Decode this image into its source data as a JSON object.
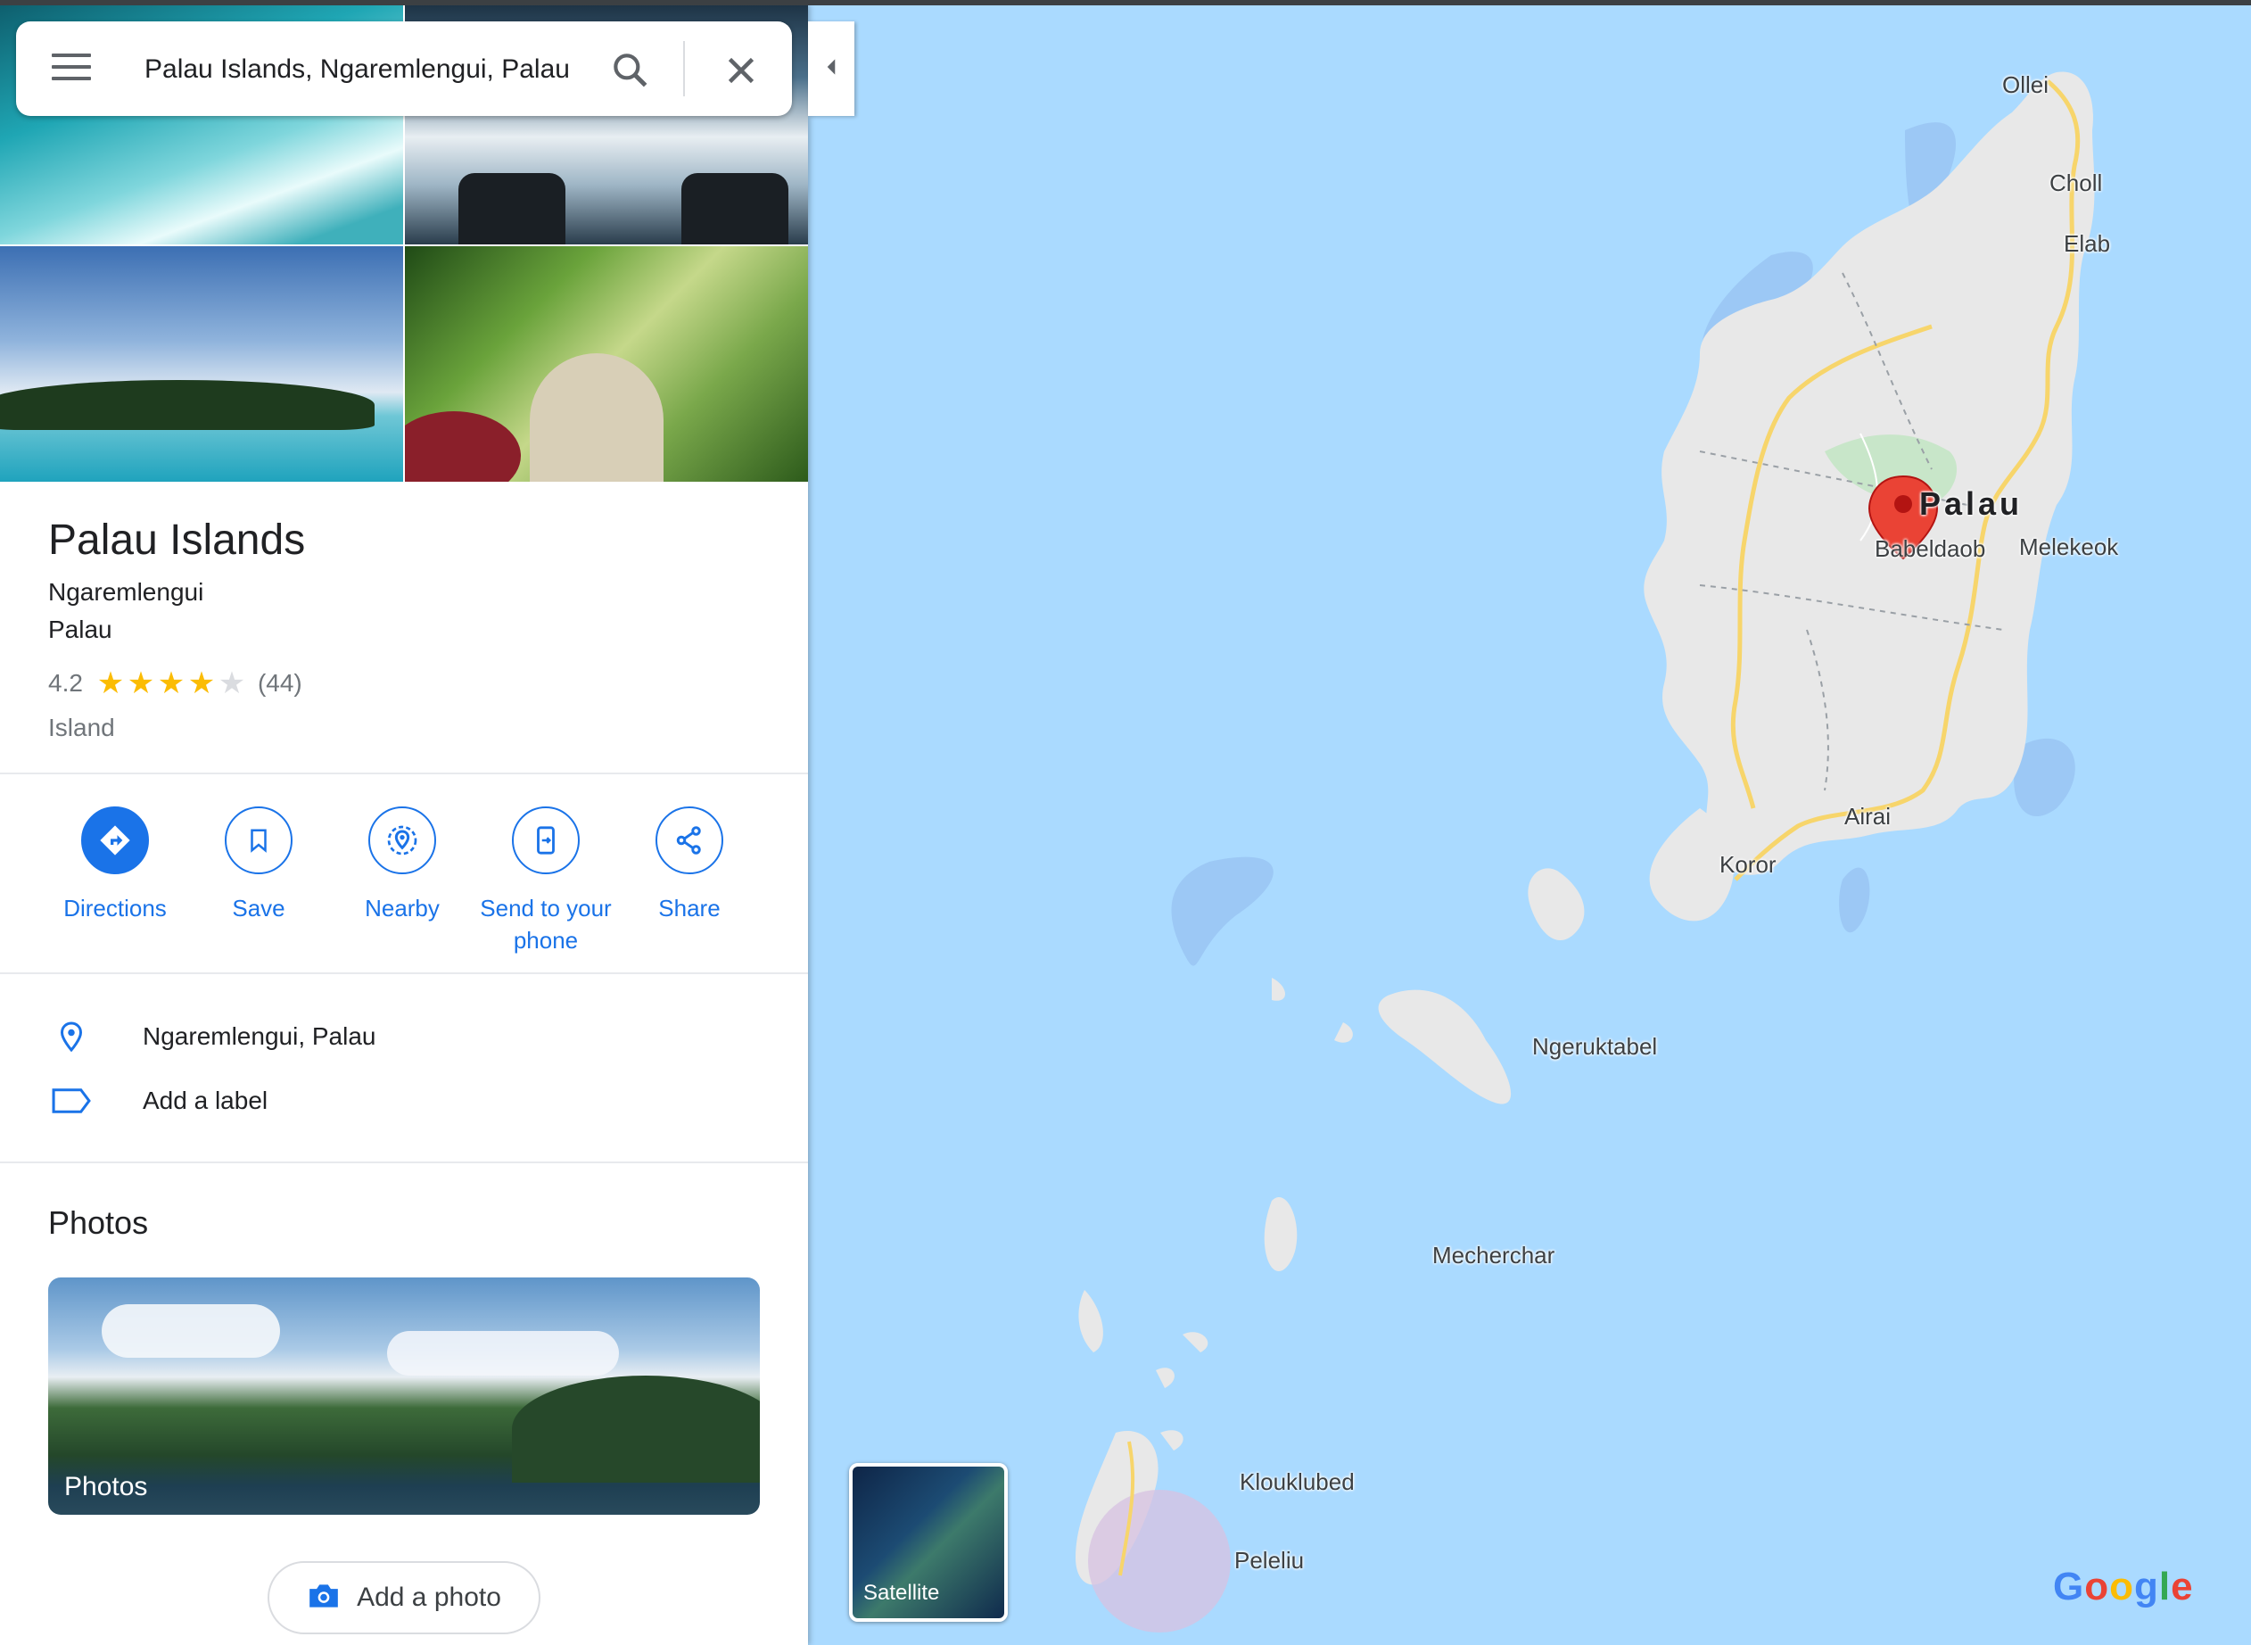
{
  "search": {
    "value": "Palau Islands, Ngaremlengui, Palau"
  },
  "place": {
    "title": "Palau Islands",
    "address_line1": "Ngaremlengui",
    "address_line2": "Palau",
    "rating": "4.2",
    "rating_stars": 4.2,
    "review_count": "(44)",
    "category": "Island"
  },
  "actions": [
    {
      "label": "Directions",
      "icon": "directions-icon"
    },
    {
      "label": "Save",
      "icon": "bookmark-icon"
    },
    {
      "label": "Nearby",
      "icon": "nearby-icon"
    },
    {
      "label": "Send to your phone",
      "icon": "send-to-phone-icon"
    },
    {
      "label": "Share",
      "icon": "share-icon"
    }
  ],
  "info": {
    "location": "Ngaremlengui, Palau",
    "add_label": "Add a label"
  },
  "photos": {
    "heading": "Photos",
    "card_caption": "Photos",
    "add_photo": "Add a photo"
  },
  "map": {
    "country_label": "Palau",
    "labels": [
      "Ollei",
      "Choll",
      "Elab",
      "Babeldaob",
      "Melekeok",
      "Airai",
      "Koror",
      "Ngeruktabel",
      "Mecherchar",
      "Klouklubed",
      "Peleliu"
    ],
    "satellite_label": "Satellite",
    "logo": "Google"
  },
  "colors": {
    "accent": "#1a73e8",
    "water": "#aadaff",
    "land": "#e8e8e8",
    "road": "#f7d56b",
    "pin": "#ea4335",
    "star": "#fbbc04"
  }
}
